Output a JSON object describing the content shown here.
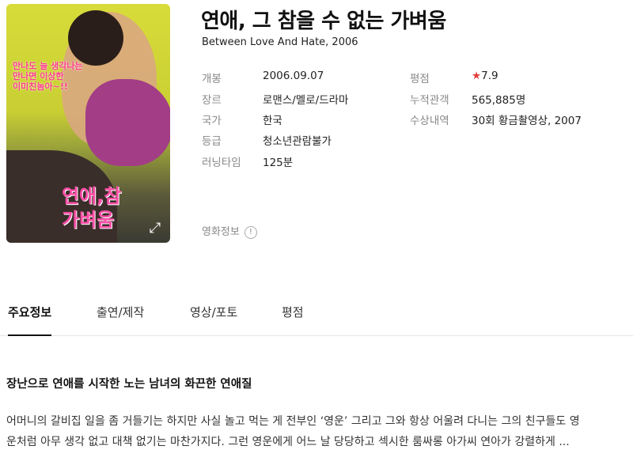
{
  "poster": {
    "tagline": "만나도 늘 생각나는\n만나면 이상한\n이미친놈아~!!",
    "title": "연애,참\n가벼움"
  },
  "movie": {
    "title": "연애, 그 참을 수 없는 가벼움",
    "subtitle": "Between Love And Hate, 2006"
  },
  "details_left": [
    {
      "label": "개봉",
      "value": "2006.09.07"
    },
    {
      "label": "장르",
      "value": "로맨스/멜로/드라마"
    },
    {
      "label": "국가",
      "value": "한국"
    },
    {
      "label": "등급",
      "value": "청소년관람불가"
    },
    {
      "label": "러닝타임",
      "value": "125분"
    }
  ],
  "details_right": {
    "rating_label": "평점",
    "rating_star": "★",
    "rating_value": "7.9",
    "audience_label": "누적관객",
    "audience_value": "565,885명",
    "awards_label": "수상내역",
    "awards_value": "30회 황금촬영상, 2007"
  },
  "info_link": {
    "label": "영화정보",
    "icon": "!"
  },
  "tabs": [
    "주요정보",
    "출연/제작",
    "영상/포토",
    "평점"
  ],
  "section": {
    "heading": "장난으로 연애를 시작한 노는 남녀의 화끈한 연애질",
    "synopsis_line1": "어머니의 갈비집 일을 좀 거들기는 하지만 사실 놀고 먹는 게 전부인 ‘영운’ 그리고 그와 항상 어울려 다니는 그의 친구들도 영",
    "synopsis_line2": "운처럼 아무 생각 없고 대책 없기는 마찬가지다. 그런 영운에게 어느 날 당당하고 섹시한 룸싸롱 아가씨 연아가 강렬하게 ..."
  },
  "colors": {
    "accent_link": "#3a6fbf",
    "star": "#e63c3c"
  }
}
